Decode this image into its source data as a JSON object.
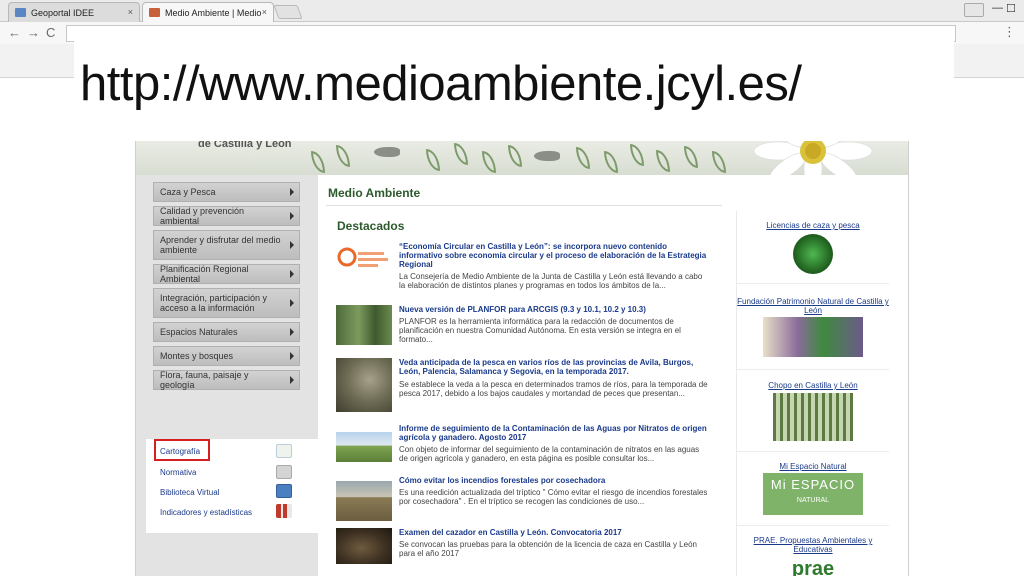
{
  "browser": {
    "tabs": [
      {
        "label": "Geoportal IDEE",
        "close": "×"
      },
      {
        "label": "Medio Ambiente | Medio",
        "close": "×"
      }
    ],
    "nav": {
      "back": "←",
      "forward": "→",
      "reload": "C"
    },
    "window_controls": {
      "minimize": "—",
      "maximize": "☐",
      "close": "✕"
    },
    "menu": "⋮"
  },
  "slide": {
    "title": "http://www.medioambiente.jcyl.es/"
  },
  "site": {
    "banner": {
      "brand": "de Castilla y León"
    },
    "sidebar": {
      "items": [
        {
          "label": "Caza y Pesca"
        },
        {
          "label": "Calidad y prevención ambiental"
        },
        {
          "label": "Aprender y disfrutar del medio ambiente"
        },
        {
          "label": "Planificación Regional Ambiental"
        },
        {
          "label": "Integración, participación y acceso a la información"
        },
        {
          "label": "Espacios Naturales"
        },
        {
          "label": "Montes y bosques"
        },
        {
          "label": "Flora, fauna, paisaje y geología"
        }
      ],
      "tools": [
        {
          "label": "Cartografía"
        },
        {
          "label": "Normativa"
        },
        {
          "label": "Biblioteca Virtual"
        },
        {
          "label": "Indicadores y estadísticas"
        }
      ]
    },
    "main": {
      "section_title": "Medio Ambiente",
      "featured_title": "Destacados",
      "news": [
        {
          "headline": "“Economía Circular en Castilla y León”: se incorpora nuevo contenido informativo sobre economía circular y el proceso de elaboración de la Estrategia Regional",
          "body": "La Consejería de Medio Ambiente de la Junta de Castilla y León está llevando a cabo la elaboración de distintos planes y programas en todos los ámbitos de la..."
        },
        {
          "headline": "Nueva versión de PLANFOR para ARCGIS (9.3 y 10.1, 10.2 y 10.3)",
          "body": "PLANFOR es la herramienta informática para la redacción de documentos de planificación en nuestra Comunidad Autónoma. En esta versión se integra en el formato..."
        },
        {
          "headline": "Veda anticipada de la pesca en varios ríos de las provincias de Avila, Burgos, León, Palencia, Salamanca y Segovia, en la temporada 2017.",
          "body": "Se establece la veda a la pesca en determinados tramos de ríos, para la temporada de pesca 2017, debido a los bajos caudales y mortandad de peces que presentan..."
        },
        {
          "headline": "Informe de seguimiento de la Contaminación de las Aguas por Nitratos de origen agrícola y ganadero. Agosto 2017",
          "body": "Con objeto de informar del seguimiento de la contaminación de nitratos en las aguas de origen agrícola y ganadero, en esta página es posible consultar los..."
        },
        {
          "headline": "Cómo evitar los incendios forestales por cosechadora",
          "body": "Es una reedición actualizada del tríptico \" Cómo evitar el riesgo de incendios forestales por cosechadora\" . En el tríptico se recogen las condiciones de uso..."
        },
        {
          "headline": "Examen del cazador en Castilla y León. Convocatoria 2017",
          "body": "Se convocan las pruebas para la obtención de la licencia de caza en Castilla y León para el año 2017"
        }
      ]
    },
    "promos": [
      {
        "label": "Licencias de caza y pesca"
      },
      {
        "label": "Fundación Patrimonio Natural de Castilla y León"
      },
      {
        "label": "Chopo en Castilla y León"
      },
      {
        "label": "Mi Espacio Natural",
        "image_text": "Mi ESPACIO",
        "image_subtext": "NATURAL"
      },
      {
        "label": "PRAE. Propuestas Ambientales y Educativas",
        "image_text": "prae"
      }
    ]
  }
}
